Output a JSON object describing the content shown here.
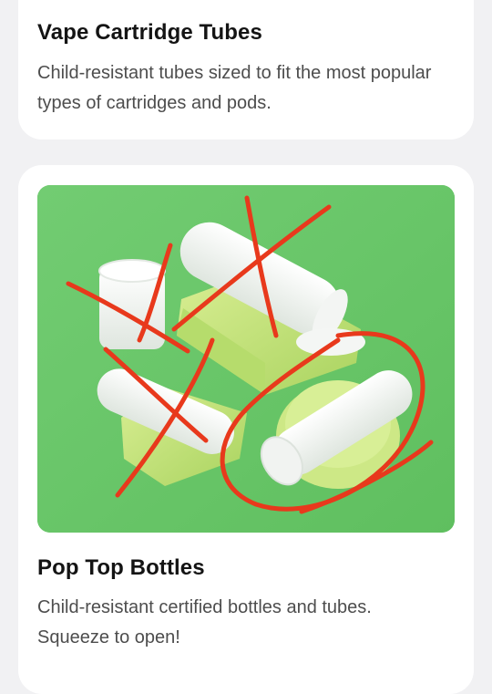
{
  "cards": [
    {
      "title": "Vape Cartridge Tubes",
      "description": "Child-resistant tubes sized to fit the most popular types of cartridges and pods."
    },
    {
      "title": "Pop Top Bottles",
      "description": "Child-resistant certified bottles and tubes. Squeeze to open!",
      "image": "product-photo-white-bottles-and-tubes-on-green-with-red-scribbles"
    }
  ],
  "colors": {
    "page_bg": "#f1f1f3",
    "card_bg": "#ffffff",
    "photo_bg": "#66c366",
    "scribble": "#e8391c"
  }
}
